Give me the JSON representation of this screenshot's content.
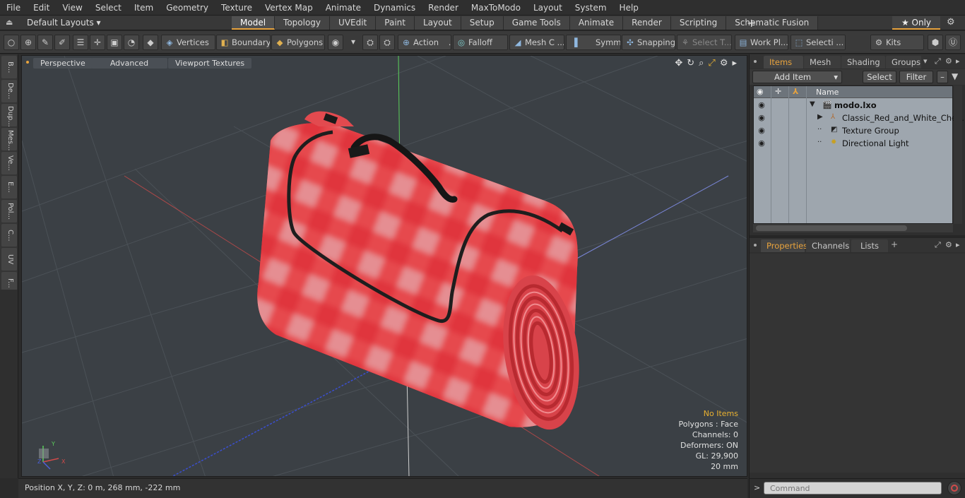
{
  "menu": [
    "File",
    "Edit",
    "View",
    "Select",
    "Item",
    "Geometry",
    "Texture",
    "Vertex Map",
    "Animate",
    "Dynamics",
    "Render",
    "MaxToModo",
    "Layout",
    "System",
    "Help"
  ],
  "layoutbar": {
    "layouts_label": "Default Layouts ▾",
    "tabs": [
      "Model",
      "Topology",
      "UVEdit",
      "Paint",
      "Layout",
      "Setup",
      "Game Tools",
      "Animate",
      "Render",
      "Scripting",
      "Schematic Fusion"
    ],
    "active_tab": "Model",
    "plus": "+",
    "only_label": "★ Only"
  },
  "toolbar": {
    "vertices": "Vertices",
    "boundary": "Boundary",
    "polygons": "Polygons",
    "action": "Action",
    "falloff": "Falloff",
    "mesh": "Mesh C ...",
    "symm": "Symm ...",
    "snapping": "Snapping",
    "select_t": "Select T...",
    "work_pl": "Work Pl...",
    "selecti": "Selecti ...",
    "kits": "Kits",
    "action_more": "...",
    "falloff_more": "..."
  },
  "lefttabs": [
    "B...",
    "De...",
    "Dup...",
    "Mes...",
    "Ve...",
    "E...",
    "Pol...",
    "C...",
    "UV",
    "F..."
  ],
  "viewport": {
    "tabs": [
      "Perspective",
      "Advanced",
      "Viewport Textures"
    ],
    "stats": {
      "no_items": "No Items",
      "polygons": "Polygons : Face",
      "channels": "Channels: 0",
      "deformers": "Deformers: ON",
      "gl": "GL: 29,900",
      "scale": "20 mm"
    },
    "axis_labels": {
      "y": "Y",
      "x": "X",
      "z": "Z"
    }
  },
  "status": {
    "position": "Position X, Y, Z:   0 m, 268 mm, -222 mm"
  },
  "items_panel": {
    "tabs": [
      "Items",
      "Mesh ...",
      "Shading",
      "Groups"
    ],
    "active_tab": "Items",
    "add_item": "Add Item",
    "select": "Select",
    "filter": "Filter",
    "name_header": "Name",
    "rows": [
      {
        "label": "modo.lxo",
        "bold": true,
        "indent": 0
      },
      {
        "label": "Classic_Red_and_White_Che ...",
        "bold": false,
        "indent": 1
      },
      {
        "label": "Texture Group",
        "bold": false,
        "indent": 1
      },
      {
        "label": "Directional Light",
        "bold": false,
        "indent": 1
      }
    ]
  },
  "props_panel": {
    "tabs": [
      "Properties",
      "Channels",
      "Lists"
    ],
    "active_tab": "Properties",
    "plus": "+"
  },
  "command": {
    "placeholder": "Command",
    "arrow": ">"
  },
  "colors": {
    "accent": "#e8a33d",
    "viewport_bg": "#3b4045",
    "blanket_red": "#e0363c",
    "blanket_white": "#c9cfd3"
  }
}
